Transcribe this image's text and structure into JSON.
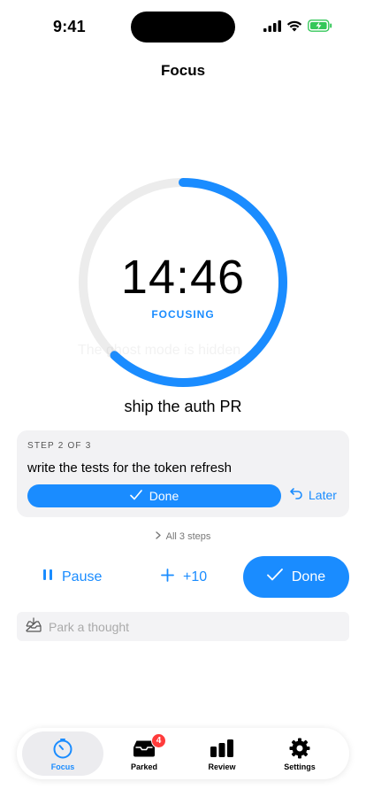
{
  "status": {
    "time": "9:41"
  },
  "nav": {
    "title": "Focus"
  },
  "timer": {
    "time": "14:46",
    "state": "FOCUSING",
    "ghost_text": "The ghost mode is hidden",
    "progress": 0.62
  },
  "task": {
    "title": "ship the auth PR"
  },
  "step": {
    "label": "STEP 2 OF 3",
    "text": "write the tests for the token refresh",
    "done_label": "Done",
    "later_label": "Later"
  },
  "all_steps": {
    "label": "All 3 steps"
  },
  "actions": {
    "pause_label": "Pause",
    "plus_label": "+10",
    "done_label": "Done"
  },
  "park": {
    "placeholder": "Park a thought"
  },
  "tabs": [
    {
      "label": "Focus",
      "icon": "timer-icon",
      "active": true
    },
    {
      "label": "Parked",
      "icon": "inbox-icon",
      "badge": "4"
    },
    {
      "label": "Review",
      "icon": "bar-chart-icon"
    },
    {
      "label": "Settings",
      "icon": "gear-icon"
    }
  ],
  "colors": {
    "accent": "#1a8cff",
    "track": "#ececec",
    "badge": "#ff3b3b",
    "battery": "#34c759"
  }
}
